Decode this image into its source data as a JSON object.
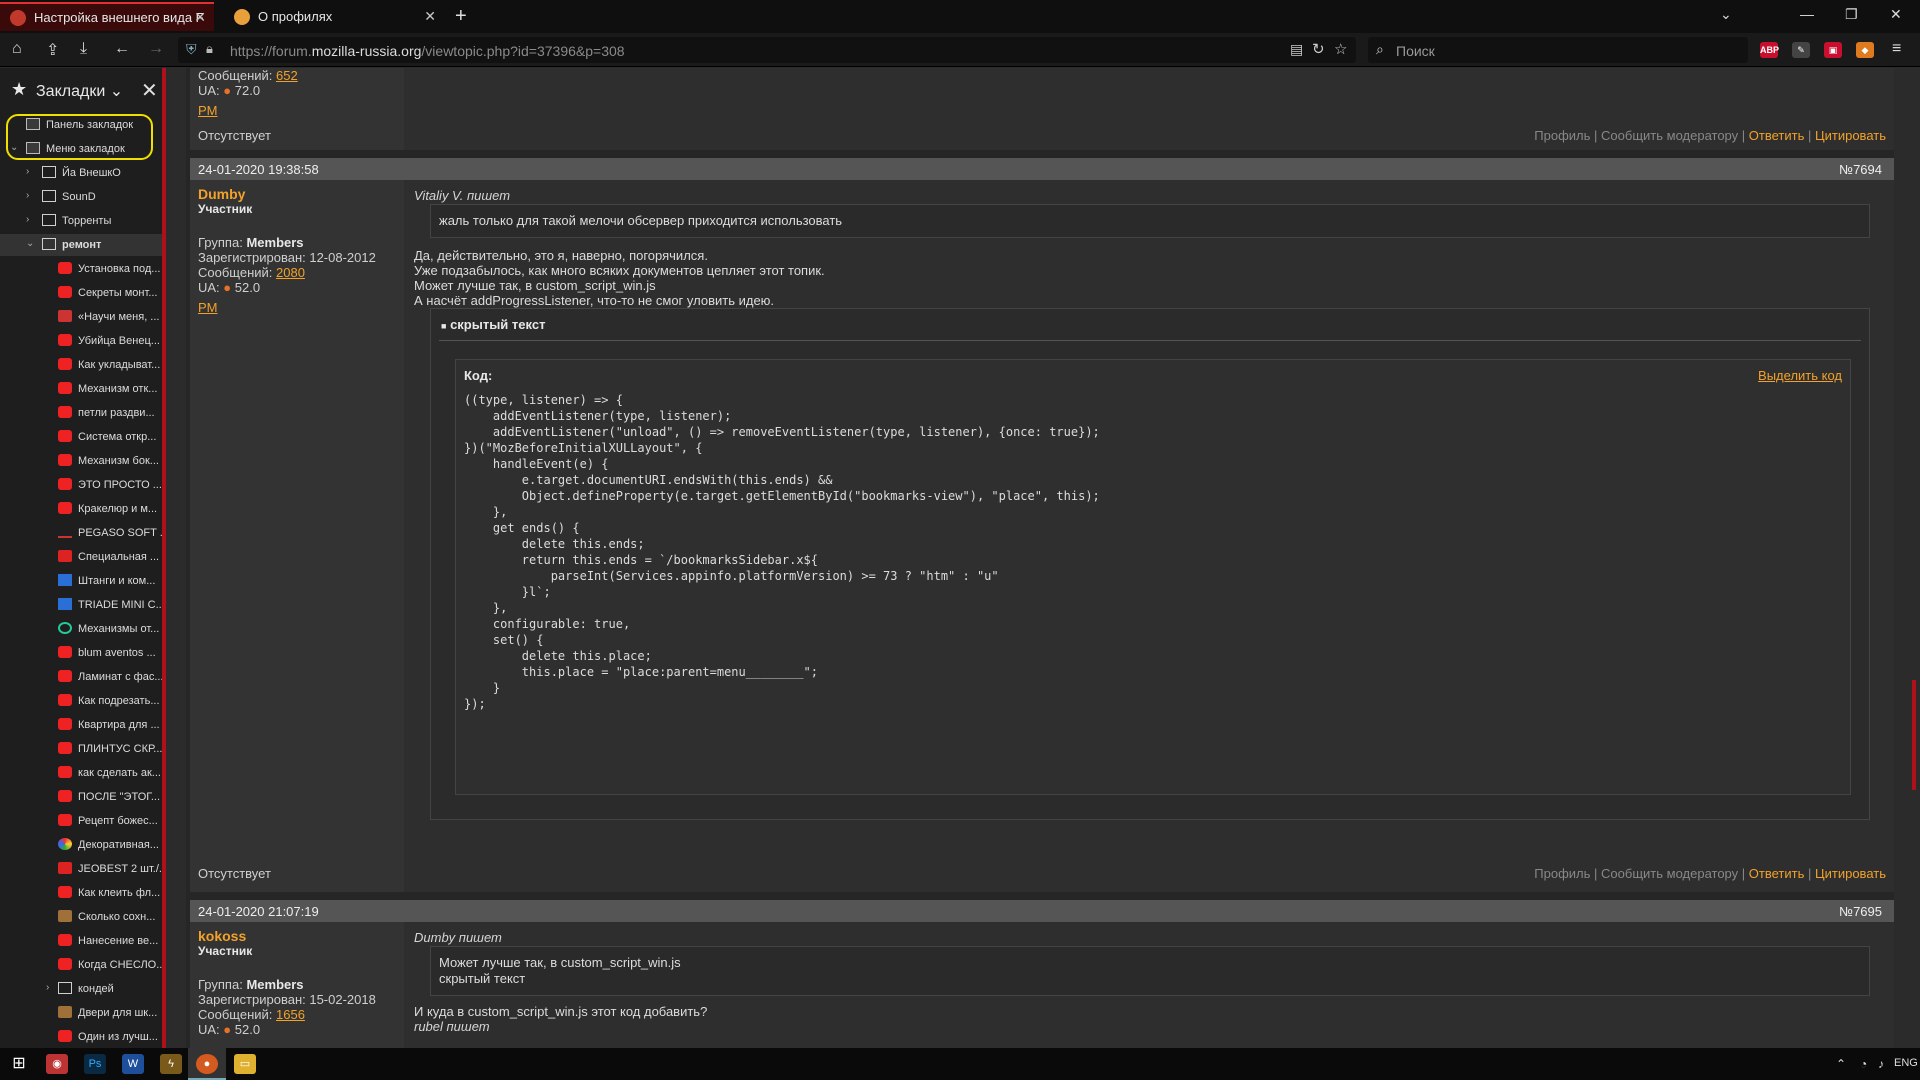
{
  "tabs": [
    {
      "title": "Настройка внешнего вида Fire",
      "active": true
    },
    {
      "title": "О профилях",
      "active": false
    }
  ],
  "nav": {
    "url_prefix": "https://forum.",
    "url_domain": "mozilla-russia.org",
    "url_path": "/viewtopic.php?id=37396&p=308",
    "search_placeholder": "Поиск"
  },
  "extensions": [
    {
      "name": "adblock-icon",
      "text": "ABP",
      "color": "#c8102e"
    },
    {
      "name": "extension-icon",
      "text": "",
      "color": "#555"
    },
    {
      "name": "lock-extension-icon",
      "text": "",
      "color": "#c8102e"
    },
    {
      "name": "metamask-icon",
      "text": "",
      "color": "#e07a1f"
    }
  ],
  "sidebar": {
    "title": "Закладки",
    "items": [
      {
        "label": "Панель закладок",
        "indent": 0,
        "kind": "special",
        "twisty": ""
      },
      {
        "label": "Меню закладок",
        "indent": 0,
        "kind": "special",
        "twisty": "v"
      },
      {
        "label": "Йа ВнешкО",
        "indent": 1,
        "kind": "folder",
        "twisty": ">"
      },
      {
        "label": "SounD",
        "indent": 1,
        "kind": "folder",
        "twisty": ">"
      },
      {
        "label": "Торренты",
        "indent": 1,
        "kind": "folder",
        "twisty": ">"
      },
      {
        "label": "ремонт",
        "indent": 1,
        "kind": "folder",
        "twisty": "v",
        "selected": true
      },
      {
        "label": "Установка под...",
        "indent": 2,
        "kind": "yt"
      },
      {
        "label": "Секреты монт...",
        "indent": 2,
        "kind": "yt"
      },
      {
        "label": "«Научи меня, ...",
        "indent": 2,
        "kind": "tn"
      },
      {
        "label": "Убийца Венец...",
        "indent": 2,
        "kind": "yt"
      },
      {
        "label": "Как укладыват...",
        "indent": 2,
        "kind": "yt"
      },
      {
        "label": "Механизм отк...",
        "indent": 2,
        "kind": "yt"
      },
      {
        "label": "петли раздви...",
        "indent": 2,
        "kind": "yt"
      },
      {
        "label": "Система откр...",
        "indent": 2,
        "kind": "yt"
      },
      {
        "label": "Механизм бок...",
        "indent": 2,
        "kind": "yt"
      },
      {
        "label": "ЭТО ПРОСТО ...",
        "indent": 2,
        "kind": "yt"
      },
      {
        "label": "Кракелюр и м...",
        "indent": 2,
        "kind": "yt"
      },
      {
        "label": "PEGASO SOFT ...",
        "indent": 2,
        "kind": "pg"
      },
      {
        "label": "Специальная ...",
        "indent": 2,
        "kind": "sp"
      },
      {
        "label": "Штанги и ком...",
        "indent": 2,
        "kind": "m"
      },
      {
        "label": "TRIADE MINI C...",
        "indent": 2,
        "kind": "m"
      },
      {
        "label": "Механизмы от...",
        "indent": 2,
        "kind": "g"
      },
      {
        "label": "blum aventos ...",
        "indent": 2,
        "kind": "yt"
      },
      {
        "label": "Ламинат с фас...",
        "indent": 2,
        "kind": "yt"
      },
      {
        "label": "Как подрезать...",
        "indent": 2,
        "kind": "yt"
      },
      {
        "label": "Квартира для ...",
        "indent": 2,
        "kind": "yt"
      },
      {
        "label": "ПЛИНТУС СКР...",
        "indent": 2,
        "kind": "yt"
      },
      {
        "label": "как сделать ак...",
        "indent": 2,
        "kind": "yt"
      },
      {
        "label": "ПОСЛЕ \"ЭТОГ...",
        "indent": 2,
        "kind": "yt"
      },
      {
        "label": "Рецепт божес...",
        "indent": 2,
        "kind": "yt"
      },
      {
        "label": "Декоративная...",
        "indent": 2,
        "kind": "ch"
      },
      {
        "label": "JEOBEST 2 шт./...",
        "indent": 2,
        "kind": "sp"
      },
      {
        "label": "Как клеить фл...",
        "indent": 2,
        "kind": "yt"
      },
      {
        "label": "Сколько сохн...",
        "indent": 2,
        "kind": "br"
      },
      {
        "label": "Нанесение ве...",
        "indent": 2,
        "kind": "yt"
      },
      {
        "label": "Когда СНЕСЛО...",
        "indent": 2,
        "kind": "yt"
      },
      {
        "label": "кондей",
        "indent": 2,
        "kind": "folder",
        "twisty": ">"
      },
      {
        "label": "Двери для шк...",
        "indent": 2,
        "kind": "br"
      },
      {
        "label": "Один из лучш...",
        "indent": 2,
        "kind": "yt"
      }
    ]
  },
  "post0": {
    "messages_label": "Сообщений:",
    "messages": "652",
    "ua_label": "UA:",
    "ua": "72.0",
    "pm": "PM",
    "status": "Отсутствует"
  },
  "actions": {
    "profile": "Профиль",
    "sep": "|",
    "report": "Сообщить модератору",
    "reply": "Ответить",
    "quote": "Цитировать"
  },
  "post1": {
    "date": "24-01-2020 19:38:58",
    "num": "№7694",
    "author": "Dumby",
    "role": "Участник",
    "group_label": "Группа:",
    "group": "Members",
    "reg": "Зарегистрирован: 12-08-2012",
    "messages_label": "Сообщений:",
    "messages": "2080",
    "ua_label": "UA:",
    "ua": "52.0",
    "pm": "PM",
    "quote_who": "Vitaliy V. пишет",
    "quote": "жаль только для такой мелочи обсервер приходится использовать",
    "lines": [
      "Да, действительно, это я, наверно, погорячился.",
      "Уже подзабылось, как много всяких документов цепляет этот топик.",
      "Может лучше так, в custom_script_win.js",
      "А насчёт addProgressListener, что-то не смог уловить идею."
    ],
    "spoiler_title": "скрытый текст",
    "code_label": "Код:",
    "code_select": "Выделить код",
    "code": "((type, listener) => {\n    addEventListener(type, listener);\n    addEventListener(\"unload\", () => removeEventListener(type, listener), {once: true});\n})(\"MozBeforeInitialXULLayout\", {\n    handleEvent(e) {\n        e.target.documentURI.endsWith(this.ends) &&\n        Object.defineProperty(e.target.getElementById(\"bookmarks-view\"), \"place\", this);\n    },\n    get ends() {\n        delete this.ends;\n        return this.ends = `/bookmarksSidebar.x${\n            parseInt(Services.appinfo.platformVersion) >= 73 ? \"htm\" : \"u\"\n        }l`;\n    },\n    configurable: true,\n    set() {\n        delete this.place;\n        this.place = \"place:parent=menu________\";\n    }\n});",
    "status": "Отсутствует"
  },
  "post2": {
    "date": "24-01-2020 21:07:19",
    "num": "№7695",
    "author": "kokoss",
    "role": "Участник",
    "group_label": "Группа:",
    "group": "Members",
    "reg": "Зарегистрирован: 15-02-2018",
    "messages_label": "Сообщений:",
    "messages": "1656",
    "ua_label": "UA:",
    "ua": "52.0",
    "quote_who": "Dumby пишет",
    "quote_line1": "Может лучше так, в custom_script_win.js",
    "quote_line2": "скрытый текст",
    "text": "И куда  в custom_script_win.js  этот код добавить?",
    "next_quote_who": "rubel пишет"
  },
  "taskbar": {
    "lang": "ENG"
  }
}
